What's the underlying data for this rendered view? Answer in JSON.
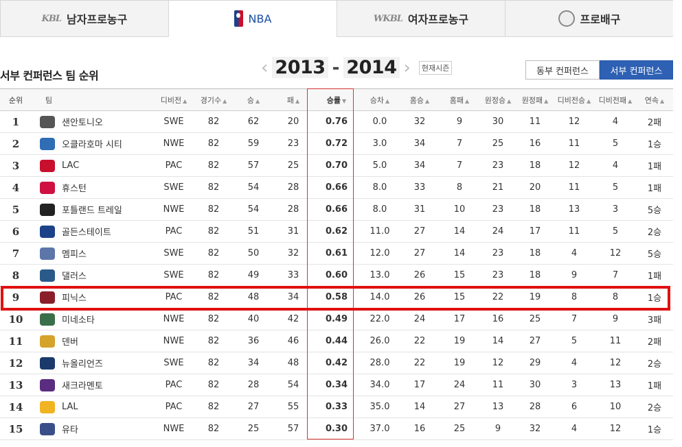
{
  "tabs": [
    {
      "logo": "KBL",
      "label": "남자프로농구"
    },
    {
      "logo": "nba-logo",
      "label": "NBA",
      "active": true
    },
    {
      "logo": "WKBL",
      "label": "여자프로농구"
    },
    {
      "logo": "volleyball-logo",
      "label": "프로배구"
    }
  ],
  "heading": "서부 컨퍼런스 팀 순위",
  "season": {
    "start": "2013",
    "end": "2014",
    "dash": "-",
    "current_label": "현재시즌"
  },
  "conference_buttons": {
    "east": "동부 컨퍼런스",
    "west": "서부 컨퍼런스",
    "selected": "west"
  },
  "columns": {
    "rank": "순위",
    "team": "팀",
    "division": "디비전",
    "games": "경기수",
    "wins": "승",
    "losses": "패",
    "pct": "승률",
    "gb": "승차",
    "home_w": "홈승",
    "home_l": "홈패",
    "away_w": "원정승",
    "away_l": "원정패",
    "div_w": "디비전승",
    "div_l": "디비전패",
    "streak": "연속"
  },
  "sort_indicator": "▲",
  "sorted_indicator": "▼",
  "highlight_rank": 9,
  "highlight_color": "#e01010",
  "rows": [
    {
      "rank": "1",
      "team": "샌안토니오",
      "logo_color": "#555555",
      "division": "SWE",
      "games": "82",
      "wins": "62",
      "losses": "20",
      "pct": "0.76",
      "gb": "0.0",
      "home_w": "32",
      "home_l": "9",
      "away_w": "30",
      "away_l": "11",
      "div_w": "12",
      "div_l": "4",
      "streak": "2패"
    },
    {
      "rank": "2",
      "team": "오클라호마 시티",
      "logo_color": "#2f6db5",
      "division": "NWE",
      "games": "82",
      "wins": "59",
      "losses": "23",
      "pct": "0.72",
      "gb": "3.0",
      "home_w": "34",
      "home_l": "7",
      "away_w": "25",
      "away_l": "16",
      "div_w": "11",
      "div_l": "5",
      "streak": "1승"
    },
    {
      "rank": "3",
      "team": "LAC",
      "logo_color": "#c8102e",
      "division": "PAC",
      "games": "82",
      "wins": "57",
      "losses": "25",
      "pct": "0.70",
      "gb": "5.0",
      "home_w": "34",
      "home_l": "7",
      "away_w": "23",
      "away_l": "18",
      "div_w": "12",
      "div_l": "4",
      "streak": "1패"
    },
    {
      "rank": "4",
      "team": "휴스턴",
      "logo_color": "#ce1141",
      "division": "SWE",
      "games": "82",
      "wins": "54",
      "losses": "28",
      "pct": "0.66",
      "gb": "8.0",
      "home_w": "33",
      "home_l": "8",
      "away_w": "21",
      "away_l": "20",
      "div_w": "11",
      "div_l": "5",
      "streak": "1패"
    },
    {
      "rank": "5",
      "team": "포틀랜드 트레일",
      "logo_color": "#222222",
      "division": "NWE",
      "games": "82",
      "wins": "54",
      "losses": "28",
      "pct": "0.66",
      "gb": "8.0",
      "home_w": "31",
      "home_l": "10",
      "away_w": "23",
      "away_l": "18",
      "div_w": "13",
      "div_l": "3",
      "streak": "5승"
    },
    {
      "rank": "6",
      "team": "골든스테이트",
      "logo_color": "#1d428a",
      "division": "PAC",
      "games": "82",
      "wins": "51",
      "losses": "31",
      "pct": "0.62",
      "gb": "11.0",
      "home_w": "27",
      "home_l": "14",
      "away_w": "24",
      "away_l": "17",
      "div_w": "11",
      "div_l": "5",
      "streak": "2승"
    },
    {
      "rank": "7",
      "team": "멤피스",
      "logo_color": "#5d76a9",
      "division": "SWE",
      "games": "82",
      "wins": "50",
      "losses": "32",
      "pct": "0.61",
      "gb": "12.0",
      "home_w": "27",
      "home_l": "14",
      "away_w": "23",
      "away_l": "18",
      "div_w": "4",
      "div_l": "12",
      "streak": "5승"
    },
    {
      "rank": "8",
      "team": "댈러스",
      "logo_color": "#2a5a8a",
      "division": "SWE",
      "games": "82",
      "wins": "49",
      "losses": "33",
      "pct": "0.60",
      "gb": "13.0",
      "home_w": "26",
      "home_l": "15",
      "away_w": "23",
      "away_l": "18",
      "div_w": "9",
      "div_l": "7",
      "streak": "1패"
    },
    {
      "rank": "9",
      "team": "피닉스",
      "logo_color": "#8a1f2a",
      "division": "PAC",
      "games": "82",
      "wins": "48",
      "losses": "34",
      "pct": "0.58",
      "gb": "14.0",
      "home_w": "26",
      "home_l": "15",
      "away_w": "22",
      "away_l": "19",
      "div_w": "8",
      "div_l": "8",
      "streak": "1승"
    },
    {
      "rank": "10",
      "team": "미네소타",
      "logo_color": "#3b6e4a",
      "division": "NWE",
      "games": "82",
      "wins": "40",
      "losses": "42",
      "pct": "0.49",
      "gb": "22.0",
      "home_w": "24",
      "home_l": "17",
      "away_w": "16",
      "away_l": "25",
      "div_w": "7",
      "div_l": "9",
      "streak": "3패"
    },
    {
      "rank": "11",
      "team": "덴버",
      "logo_color": "#d4a32a",
      "division": "NWE",
      "games": "82",
      "wins": "36",
      "losses": "46",
      "pct": "0.44",
      "gb": "26.0",
      "home_w": "22",
      "home_l": "19",
      "away_w": "14",
      "away_l": "27",
      "div_w": "5",
      "div_l": "11",
      "streak": "2패"
    },
    {
      "rank": "12",
      "team": "뉴올리언즈",
      "logo_color": "#1b3a6b",
      "division": "SWE",
      "games": "82",
      "wins": "34",
      "losses": "48",
      "pct": "0.42",
      "gb": "28.0",
      "home_w": "22",
      "home_l": "19",
      "away_w": "12",
      "away_l": "29",
      "div_w": "4",
      "div_l": "12",
      "streak": "2승"
    },
    {
      "rank": "13",
      "team": "새크라멘토",
      "logo_color": "#5a2d81",
      "division": "PAC",
      "games": "82",
      "wins": "28",
      "losses": "54",
      "pct": "0.34",
      "gb": "34.0",
      "home_w": "17",
      "home_l": "24",
      "away_w": "11",
      "away_l": "30",
      "div_w": "3",
      "div_l": "13",
      "streak": "1패"
    },
    {
      "rank": "14",
      "team": "LAL",
      "logo_color": "#f0b321",
      "division": "PAC",
      "games": "82",
      "wins": "27",
      "losses": "55",
      "pct": "0.33",
      "gb": "35.0",
      "home_w": "14",
      "home_l": "27",
      "away_w": "13",
      "away_l": "28",
      "div_w": "6",
      "div_l": "10",
      "streak": "2승"
    },
    {
      "rank": "15",
      "team": "유타",
      "logo_color": "#3a4f8a",
      "division": "NWE",
      "games": "82",
      "wins": "25",
      "losses": "57",
      "pct": "0.30",
      "gb": "37.0",
      "home_w": "16",
      "home_l": "25",
      "away_w": "9",
      "away_l": "32",
      "div_w": "4",
      "div_l": "12",
      "streak": "1승"
    }
  ]
}
